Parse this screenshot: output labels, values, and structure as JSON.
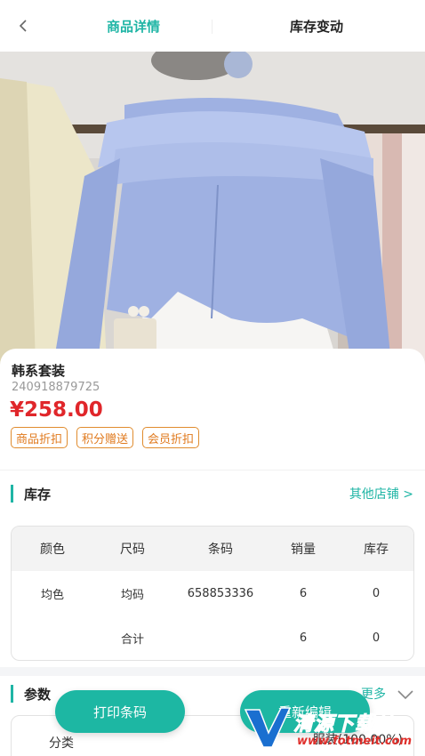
{
  "header": {
    "tabs": [
      {
        "label": "商品详情",
        "active": true
      },
      {
        "label": "库存变动",
        "active": false
      }
    ]
  },
  "product": {
    "name": "韩系套装",
    "code": "240918879725",
    "price": "¥258.00",
    "tags": [
      "商品折扣",
      "积分赠送",
      "会员折扣"
    ]
  },
  "stock": {
    "title": "库存",
    "other_shops": "其他店铺 >",
    "columns": [
      "颜色",
      "尺码",
      "条码",
      "销量",
      "库存"
    ],
    "rows": [
      {
        "color": "均色",
        "size": "均码",
        "barcode": "658853336",
        "sales": "6",
        "stock": "0"
      }
    ],
    "total": {
      "label": "合计",
      "sales": "6",
      "stock": "0"
    }
  },
  "params": {
    "title": "参数",
    "more": "更多",
    "category_label": "分类",
    "category_value": "服装(100.00%)"
  },
  "actions": {
    "print_barcode": "打印条码",
    "edit": "重新编辑"
  },
  "watermark": {
    "text": "清源下载站",
    "url": "www.fotmeit.com"
  },
  "colors": {
    "accent": "#1fb5a5",
    "price": "#e0262a",
    "tag": "#e07a1e"
  }
}
